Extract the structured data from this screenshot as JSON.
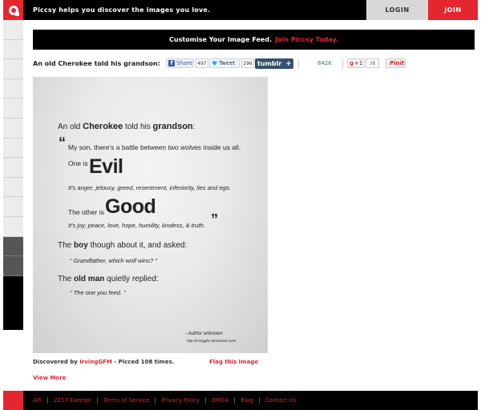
{
  "header": {
    "tagline": "Piccsy helps you discover the images you love.",
    "login_label": "LOGIN",
    "join_label": "JOIN"
  },
  "banner": {
    "text": "Customise Your Image Feed.",
    "link": "Join Piccsy Today."
  },
  "image": {
    "title": "An old Cherokee told his grandson:",
    "quote": {
      "line1_pre": "An old ",
      "line1_b1": "Cherokee",
      "line1_mid": " told his ",
      "line1_b2": "grandson",
      "line1_post": ":",
      "open_mark": "“",
      "line2_pre": "My son, there's a battle between ",
      "line2_it": "two wolves",
      "line2_post": " inside us all.",
      "line3": "One is",
      "evil": "Evil",
      "line4": "It's anger, jelousy, greed, resentment, inferiority, lies and ego.",
      "line5": "The other is",
      "good": "Good",
      "line6": "It's joy, peace, love, hope, humility, kindess, & truth.",
      "close_mark": "”",
      "line7_pre": "The ",
      "line7_b": "boy",
      "line7_post": " though about it, and asked:",
      "line8": "“ Grandfather, which wolf wins? ”",
      "line9_pre": "The ",
      "line9_b": "old man",
      "line9_post": " quietly replied:",
      "line10": "“ The one you feed. ”",
      "author": "- Author unknown",
      "url": "http://irvinggfm.deviantart.com/"
    }
  },
  "share": {
    "fb_label": "Share",
    "fb_icon": "f",
    "fb_count": "497",
    "tw_label": "Tweet",
    "tw_icon": "❦",
    "tw_count": "296",
    "tumblr_label": "tumblr",
    "tumblr_plus": "+",
    "stat_count": "842K",
    "gplus_label": "+1",
    "gplus_count": "38",
    "pin_label": "Pinit"
  },
  "meta": {
    "discovered_by": "Discovered by ",
    "user": "IrvingGFM",
    "picced": " - Picced 108 times.",
    "flag": "Flag this Image",
    "view_more": "View More"
  },
  "footer": {
    "links": [
      "API",
      "2257 Exempt",
      "Terms of Service",
      "Privacy Policy",
      "DMCA",
      "Blog",
      "Contact Us"
    ]
  },
  "colors": {
    "accent": "#e4262e",
    "tumblr": "#35506b",
    "facebook": "#3b5998"
  }
}
